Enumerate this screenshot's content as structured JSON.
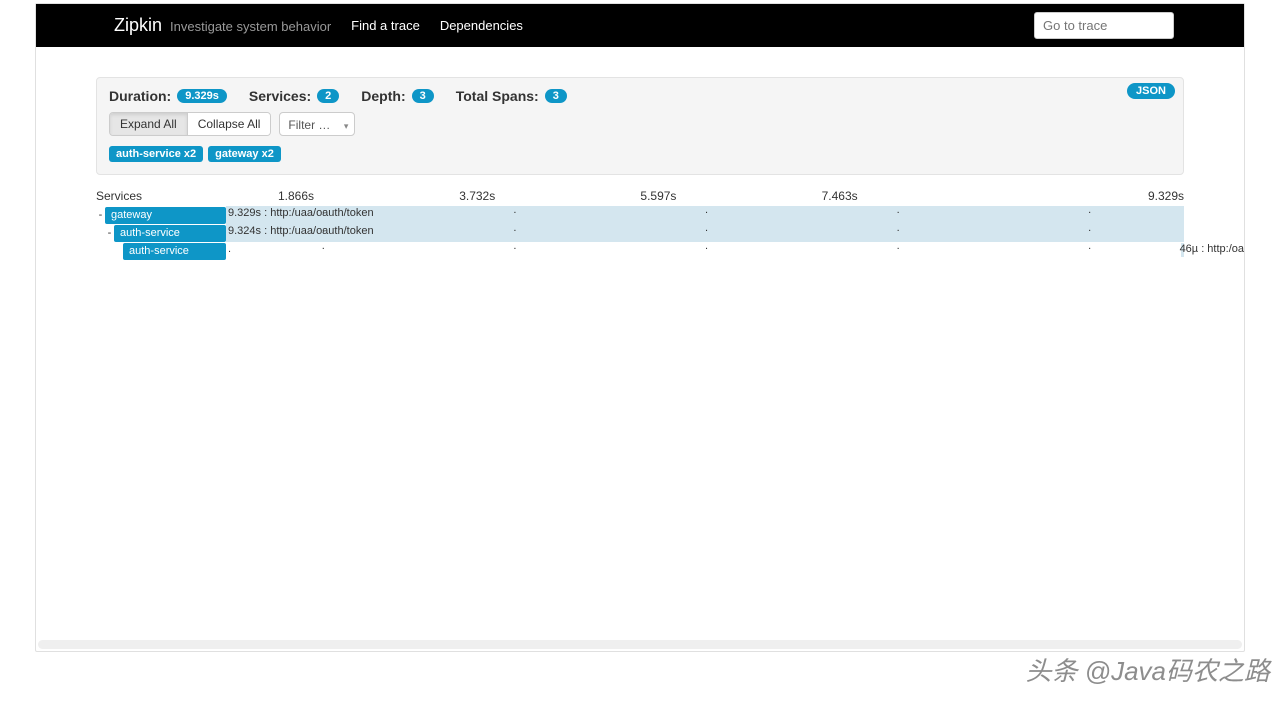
{
  "navbar": {
    "brand": "Zipkin",
    "subtitle": "Investigate system behavior",
    "find_trace": "Find a trace",
    "dependencies": "Dependencies",
    "go_to_trace_placeholder": "Go to trace"
  },
  "summary": {
    "duration_label": "Duration:",
    "duration_value": "9.329s",
    "services_label": "Services:",
    "services_value": "2",
    "depth_label": "Depth:",
    "depth_value": "3",
    "total_spans_label": "Total Spans:",
    "total_spans_value": "3",
    "json_label": "JSON",
    "expand_all": "Expand All",
    "collapse_all": "Collapse All",
    "filter_label": "Filter S…"
  },
  "tags": {
    "tag1": "auth-service x2",
    "tag2": "gateway x2"
  },
  "table_header": {
    "services": "Services",
    "t1": "1.866s",
    "t2": "3.732s",
    "t3": "5.597s",
    "t4": "7.463s",
    "t5": "9.329s"
  },
  "rows": {
    "r0": {
      "service": "gateway",
      "text": "9.329s : http:/uaa/oauth/token",
      "indent": 0,
      "toggle": "-"
    },
    "r1": {
      "service": "auth-service",
      "text": "9.324s : http:/uaa/oauth/token",
      "indent": 1,
      "toggle": "-"
    },
    "r2": {
      "service": "auth-service",
      "text": ".",
      "right_text": "46µ : http:/oa",
      "indent": 2,
      "toggle": ""
    }
  },
  "watermark": "头条 @Java码农之路"
}
